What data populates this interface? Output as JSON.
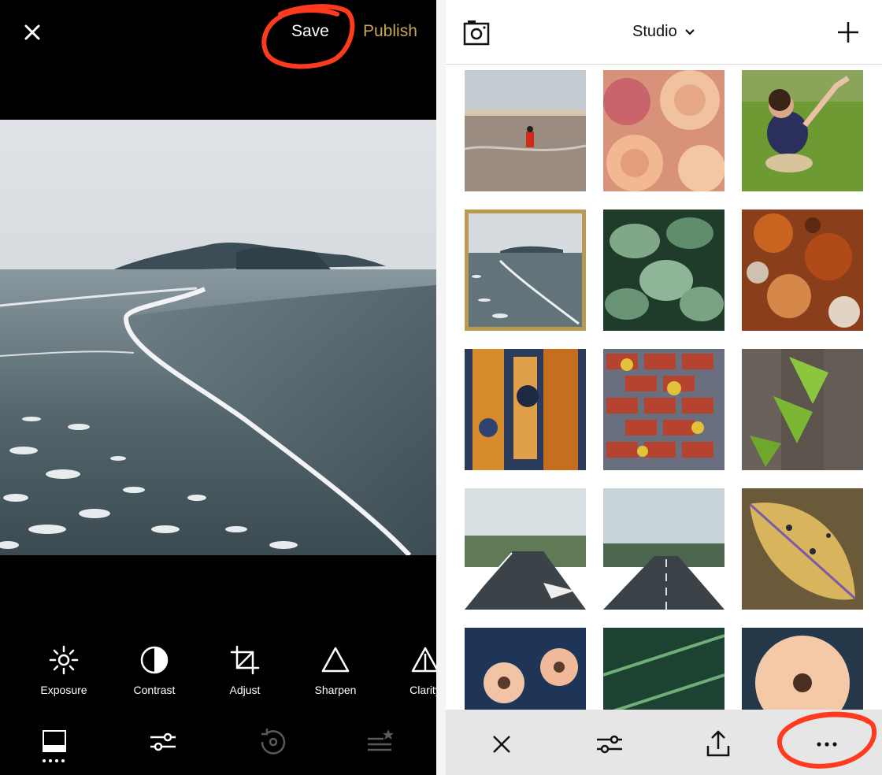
{
  "editor": {
    "save_label": "Save",
    "publish_label": "Publish",
    "accent_color": "#c9a55c",
    "tools": [
      {
        "icon": "sun-icon",
        "label": "Exposure"
      },
      {
        "icon": "contrast-icon",
        "label": "Contrast"
      },
      {
        "icon": "crop-icon",
        "label": "Adjust"
      },
      {
        "icon": "triangle-icon",
        "label": "Sharpen"
      },
      {
        "icon": "clarity-icon",
        "label": "Clarity"
      }
    ],
    "bottom_nav": [
      "presets-icon",
      "sliders-icon",
      "history-icon",
      "recipes-icon"
    ]
  },
  "studio": {
    "title": "Studio",
    "selected_color": "#b89a53",
    "footer_actions": [
      "close-icon",
      "sliders-icon",
      "share-icon",
      "more-icon"
    ]
  },
  "annotation_color": "#ff3b1f"
}
